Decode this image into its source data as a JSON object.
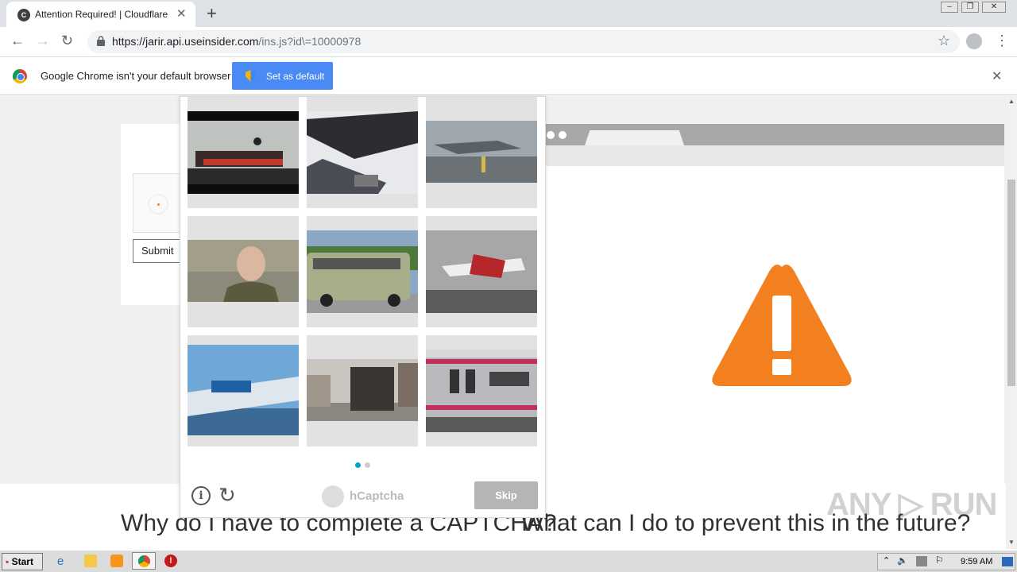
{
  "browser": {
    "tab_title": "Attention Required! | Cloudflare",
    "favicon": "cloudflare-favicon",
    "url_host": "https://jarir.api.useinsider.com",
    "url_path": "/ins.js?id\\=10000978"
  },
  "infobar": {
    "message": "Google Chrome isn't your default browser",
    "button_label": "Set as default"
  },
  "page": {
    "submit_label": "Submit",
    "heading_left": "Why do I have to complete a CAPTCHA?",
    "heading_right": "What can I do to prevent this in the future?",
    "warning_color": "#f38020"
  },
  "captcha": {
    "brand": "hCaptcha",
    "skip_label": "Skip",
    "page_indicator": {
      "current": 1,
      "total": 2
    },
    "images": [
      "dragon-boat-race",
      "motorcycle-closeup",
      "jet-on-carrier-deck",
      "soldier-portrait",
      "green-bus",
      "red-white-propeller-plane",
      "blue-aerobatic-plane",
      "city-street-bus",
      "pink-striped-train"
    ]
  },
  "taskbar": {
    "start_label": "Start",
    "clock": "9:59 AM"
  },
  "watermark": "ANY RUN"
}
